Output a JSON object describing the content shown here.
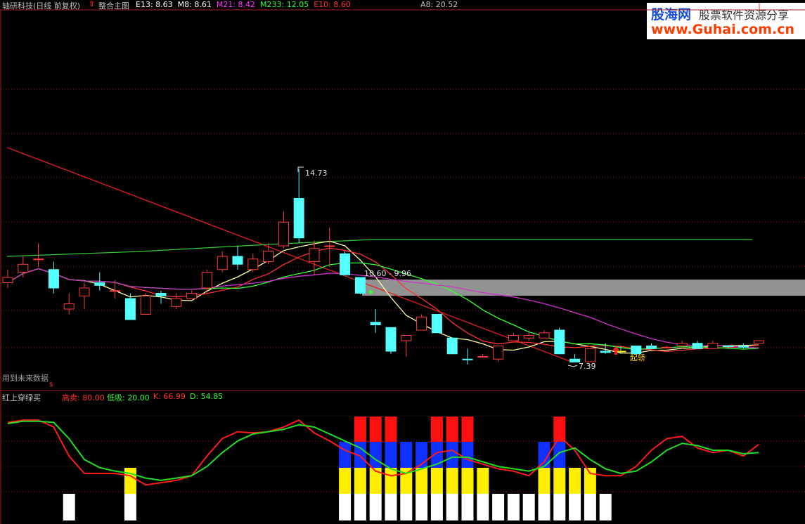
{
  "header": {
    "stock_title": "轴研科技(日线 前复权)",
    "indicator_name": "整合主图",
    "ma_values": [
      {
        "label": "E13: 8.63",
        "color": "#ffffff"
      },
      {
        "label": "M8: 8.61",
        "color": "#ffffff"
      },
      {
        "label": "M21: 8.42",
        "color": "#ff33ff"
      },
      {
        "label": "M233: 12.05",
        "color": "#33ff33"
      },
      {
        "label": "E10: 8.60",
        "color": "#ff3333"
      }
    ],
    "a8_value": "A8: 20.52"
  },
  "watermark": {
    "brand": "股海网",
    "slogan": "股票软件资源分享",
    "url": "www.Guhai.com.cn"
  },
  "price_chart": {
    "high_label": "14.73",
    "range_label": "10.60 - 9.96",
    "low_label": "7.39",
    "signal_label": "起轿",
    "future_data_note": "用到未来数据",
    "dollar_mark": "$"
  },
  "sub_chart": {
    "name": "红上穿绿买",
    "high_sell": "高卖: 80.00",
    "low_buy": "低吸: 20.00",
    "k_value": "K: 66.99",
    "d_value": "D: 54.85"
  },
  "chart_data": {
    "type": "candlestick",
    "candles": [
      {
        "o": 10.6,
        "c": 10.4,
        "h": 10.9,
        "l": 10.2,
        "up": true
      },
      {
        "o": 10.8,
        "c": 11.1,
        "h": 11.4,
        "l": 10.6,
        "up": true
      },
      {
        "o": 11.3,
        "c": 11.3,
        "h": 11.9,
        "l": 11.0,
        "up": true
      },
      {
        "o": 10.9,
        "c": 10.2,
        "h": 11.2,
        "l": 10.0,
        "up": false
      },
      {
        "o": 9.4,
        "c": 9.6,
        "h": 10.0,
        "l": 9.2,
        "up": true
      },
      {
        "o": 9.9,
        "c": 10.2,
        "h": 10.4,
        "l": 9.4,
        "up": true
      },
      {
        "o": 10.3,
        "c": 10.4,
        "h": 10.8,
        "l": 10.1,
        "up": false
      },
      {
        "o": 10.1,
        "c": 10.1,
        "h": 10.5,
        "l": 9.8,
        "up": true
      },
      {
        "o": 9.8,
        "c": 9.0,
        "h": 10.0,
        "l": 9.0,
        "up": false
      },
      {
        "o": 9.2,
        "c": 9.9,
        "h": 10.0,
        "l": 9.2,
        "up": true
      },
      {
        "o": 10.0,
        "c": 9.9,
        "h": 10.1,
        "l": 9.6,
        "up": false
      },
      {
        "o": 9.5,
        "c": 9.8,
        "h": 10.0,
        "l": 9.4,
        "up": true
      },
      {
        "o": 9.8,
        "c": 10.0,
        "h": 10.1,
        "l": 9.8,
        "up": true
      },
      {
        "o": 10.2,
        "c": 10.8,
        "h": 10.9,
        "l": 10.0,
        "up": true
      },
      {
        "o": 10.9,
        "c": 11.4,
        "h": 11.6,
        "l": 10.8,
        "up": true
      },
      {
        "o": 11.4,
        "c": 11.1,
        "h": 11.8,
        "l": 10.9,
        "up": false
      },
      {
        "o": 10.9,
        "c": 11.3,
        "h": 11.5,
        "l": 10.8,
        "up": true
      },
      {
        "o": 11.2,
        "c": 11.6,
        "h": 11.9,
        "l": 11.1,
        "up": true
      },
      {
        "o": 11.8,
        "c": 12.7,
        "h": 13.1,
        "l": 11.7,
        "up": true
      },
      {
        "o": 13.6,
        "c": 12.1,
        "h": 14.73,
        "l": 11.9,
        "up": false
      },
      {
        "o": 11.2,
        "c": 11.7,
        "h": 12.0,
        "l": 10.7,
        "up": true
      },
      {
        "o": 11.8,
        "c": 11.8,
        "h": 12.5,
        "l": 11.0,
        "up": true
      },
      {
        "o": 11.5,
        "c": 10.7,
        "h": 11.6,
        "l": 10.7,
        "up": false
      },
      {
        "o": 10.6,
        "c": 10.0,
        "h": 10.6,
        "l": 9.96,
        "up": false
      },
      {
        "o": 8.8,
        "c": 8.9,
        "h": 9.4,
        "l": 8.5,
        "up": false
      },
      {
        "o": 8.7,
        "c": 7.8,
        "h": 8.7,
        "l": 7.7,
        "up": false
      },
      {
        "o": 8.2,
        "c": 8.4,
        "h": 8.4,
        "l": 7.6,
        "up": true
      },
      {
        "o": 8.6,
        "c": 9.1,
        "h": 9.2,
        "l": 8.6,
        "up": true
      },
      {
        "o": 9.2,
        "c": 8.5,
        "h": 9.2,
        "l": 8.5,
        "up": false
      },
      {
        "o": 8.3,
        "c": 7.7,
        "h": 8.3,
        "l": 7.7,
        "up": false
      },
      {
        "o": 7.5,
        "c": 7.5,
        "h": 7.9,
        "l": 7.3,
        "up": false
      },
      {
        "o": 7.6,
        "c": 7.6,
        "h": 7.7,
        "l": 7.6,
        "up": true
      },
      {
        "o": 7.5,
        "c": 8.0,
        "h": 8.0,
        "l": 7.4,
        "up": true
      },
      {
        "o": 8.2,
        "c": 8.4,
        "h": 8.5,
        "l": 8.2,
        "up": true
      },
      {
        "o": 8.4,
        "c": 8.3,
        "h": 8.6,
        "l": 8.2,
        "up": true
      },
      {
        "o": 8.3,
        "c": 8.5,
        "h": 8.6,
        "l": 8.3,
        "up": true
      },
      {
        "o": 8.6,
        "c": 7.7,
        "h": 8.7,
        "l": 7.7,
        "up": false
      },
      {
        "o": 7.39,
        "c": 7.5,
        "h": 7.7,
        "l": 7.39,
        "up": false
      },
      {
        "o": 7.4,
        "c": 7.9,
        "h": 7.9,
        "l": 7.4,
        "up": true
      },
      {
        "o": 7.8,
        "c": 7.75,
        "h": 8.1,
        "l": 7.7,
        "up": false
      },
      {
        "o": 7.8,
        "c": 7.8,
        "h": 8.0,
        "l": 7.7,
        "up": false
      },
      {
        "o": 8.0,
        "c": 7.7,
        "h": 8.0,
        "l": 7.7,
        "up": false
      },
      {
        "o": 7.9,
        "c": 8.0,
        "h": 8.1,
        "l": 7.9,
        "up": false
      },
      {
        "o": 7.95,
        "c": 7.95,
        "h": 8.0,
        "l": 7.9,
        "up": true
      },
      {
        "o": 8.0,
        "c": 8.1,
        "h": 8.2,
        "l": 7.9,
        "up": true
      },
      {
        "o": 8.1,
        "c": 7.9,
        "h": 8.2,
        "l": 7.9,
        "up": false
      },
      {
        "o": 7.9,
        "c": 8.1,
        "h": 8.2,
        "l": 7.9,
        "up": true
      },
      {
        "o": 8.0,
        "c": 8.0,
        "h": 8.0,
        "l": 7.9,
        "up": false
      },
      {
        "o": 7.95,
        "c": 8.0,
        "h": 8.1,
        "l": 7.9,
        "up": false
      },
      {
        "o": 8.1,
        "c": 8.2,
        "h": 8.2,
        "l": 8.1,
        "up": true
      }
    ],
    "k_series": [
      84,
      86,
      86,
      80,
      55,
      40,
      40,
      40,
      38,
      30,
      32,
      34,
      38,
      55,
      70,
      76,
      75,
      76,
      80,
      86,
      75,
      68,
      60,
      55,
      42,
      38,
      40,
      48,
      58,
      60,
      52,
      48,
      44,
      42,
      38,
      50,
      72,
      60,
      40,
      38,
      38,
      46,
      60,
      70,
      72,
      62,
      58,
      60,
      55,
      65
    ],
    "d_series": [
      83,
      85,
      85,
      84,
      70,
      52,
      45,
      42,
      40,
      36,
      34,
      36,
      38,
      46,
      58,
      68,
      74,
      76,
      78,
      82,
      80,
      74,
      68,
      62,
      52,
      44,
      40,
      44,
      48,
      54,
      54,
      50,
      46,
      44,
      42,
      46,
      58,
      62,
      52,
      44,
      40,
      42,
      50,
      60,
      66,
      64,
      60,
      60,
      57,
      58
    ]
  }
}
